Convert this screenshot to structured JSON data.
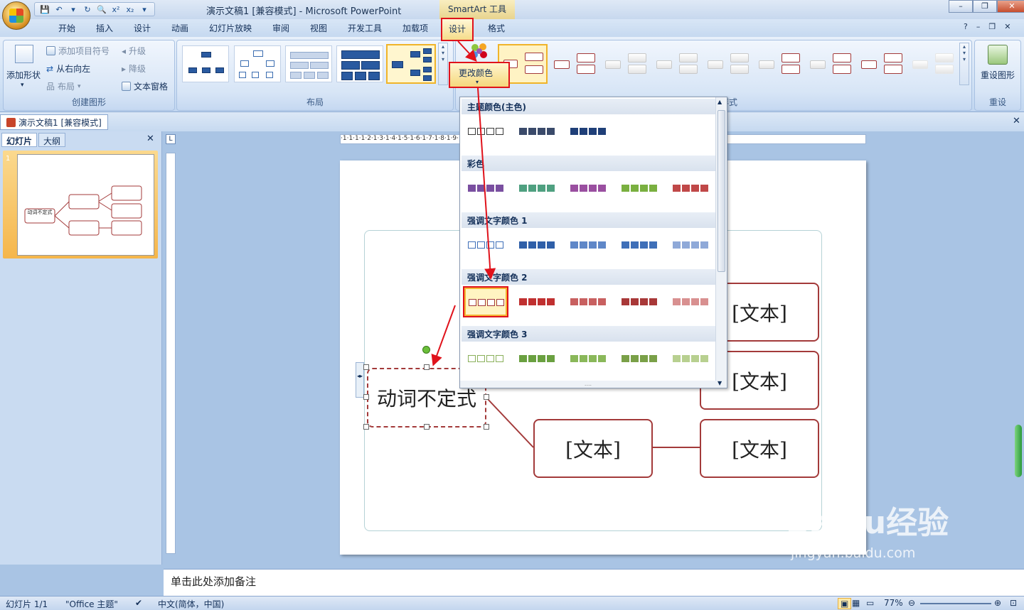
{
  "app": {
    "title": "演示文稿1 [兼容模式] - Microsoft PowerPoint",
    "context_tab_group": "SmartArt 工具",
    "window_controls": [
      "–",
      "❐",
      "✕"
    ]
  },
  "qat": [
    "💾",
    "↶",
    "▾",
    "↻",
    "🔍",
    "x²",
    "x₂",
    "▾"
  ],
  "tabs": [
    "开始",
    "插入",
    "设计",
    "动画",
    "幻灯片放映",
    "审阅",
    "视图",
    "开发工具",
    "加载项",
    "设计",
    "格式"
  ],
  "ribbon": {
    "create_graphic": {
      "label": "创建图形",
      "add_shape": "添加形状",
      "add_bullet": "添加项目符号",
      "right_to_left": "从右向左",
      "layout": "布局",
      "promote": "升级",
      "demote": "降级",
      "text_pane": "文本窗格"
    },
    "layouts": {
      "label": "布局"
    },
    "styles": {
      "label": "样式",
      "visible_label": "样式"
    },
    "change_colors": "更改颜色",
    "reset": {
      "label": "重设",
      "reset_graphic": "重设图形"
    }
  },
  "document_tab": "演示文稿1 [兼容模式]",
  "left_pane": {
    "tabs": [
      "幻灯片",
      "大纲"
    ],
    "slide_number": "1",
    "thumb_text": "动词不定式"
  },
  "ruler": {
    "h_ticks": "·1·1·1·1·2·1·3·1·4·1·5·1·6·1·7·1·8·1·9·1·10·1·11·1·12·1·13·1·14·1·15·1·16·1·17·1·18·1·19·1·20·1·21·1·22·1·23·",
    "corner": "L"
  },
  "slide": {
    "root_text": "动词不定式",
    "box_text": "[文本]"
  },
  "dropdown": {
    "sections": [
      "主题颜色(主色)",
      "彩色",
      "强调文字颜色 1",
      "强调文字颜色 2",
      "强调文字颜色 3"
    ],
    "grip": "....",
    "colors": {
      "theme": [
        "#3a3a3a",
        "#3a4a6a",
        "#1f3f78"
      ],
      "colorful": [
        "#7a4fa0",
        "#4fa080",
        "#9a4fa0",
        "#7ab040",
        "#c04848"
      ],
      "accent1": [
        "#3f6fb8",
        "#2f5fa8",
        "#5f87c8",
        "#3f6fb8",
        "#8fa9d8"
      ],
      "accent2": [
        "#a33a3a",
        "#c03030",
        "#c86060",
        "#a83838",
        "#d89090"
      ],
      "accent3": [
        "#8ab05a",
        "#6aa040",
        "#8ab85a",
        "#7aa048",
        "#b8d090"
      ]
    }
  },
  "notes_placeholder": "单击此处添加备注",
  "status": {
    "slide": "幻灯片 1/1",
    "theme": "\"Office 主题\"",
    "language": "中文(简体，中国)",
    "zoom": "77%"
  },
  "watermark": {
    "brand": "Baidu经验",
    "url": "jingyan.baidu.com"
  },
  "accent_color": "#e0121b"
}
